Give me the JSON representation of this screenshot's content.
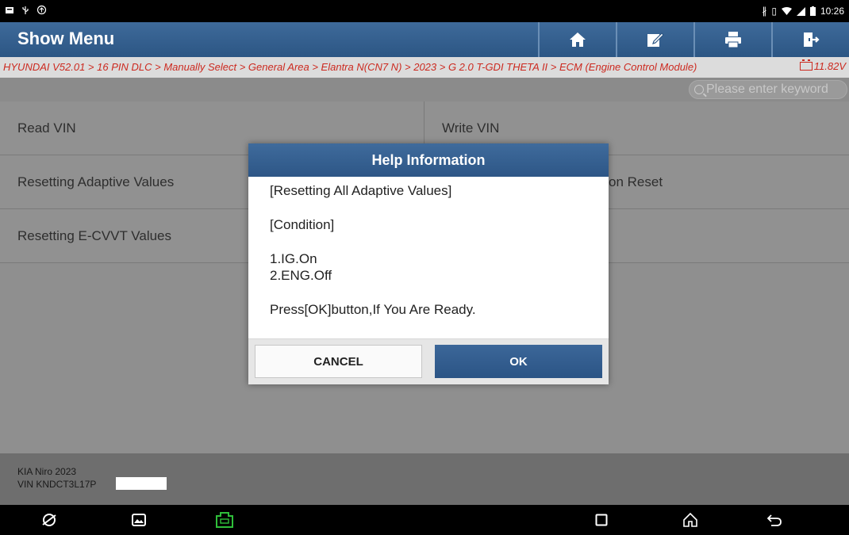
{
  "status_bar": {
    "time": "10:26",
    "left_icons": [
      "notification-icon",
      "usb-icon",
      "sync-icon"
    ],
    "right_icons": [
      "bluetooth-icon",
      "vibrate-icon",
      "wifi-icon",
      "signal-icon",
      "battery-icon"
    ]
  },
  "header": {
    "title": "Show Menu",
    "tools": [
      "home-icon",
      "edit-icon",
      "print-icon",
      "exit-icon"
    ]
  },
  "breadcrumb": {
    "path": "HYUNDAI V52.01 > 16 PIN DLC > Manually Select > General Area > Elantra N(CN7 N) > 2023 > G 2.0 T-GDI THETA II > ECM (Engine Control Module)",
    "voltage": "11.82V"
  },
  "search": {
    "placeholder": "Please enter keyword"
  },
  "menu": {
    "rows": [
      {
        "left": "Read VIN",
        "right": "Write VIN"
      },
      {
        "left": "Resetting Adaptive Values",
        "right": "on Reset"
      },
      {
        "left": "Resetting E-CVVT Values",
        "right": ""
      }
    ]
  },
  "vehicle": {
    "line1": "KIA Niro  2023",
    "line2": "VIN KNDCT3L17P"
  },
  "dialog": {
    "title": "Help Information",
    "line1": "[Resetting All Adaptive Values]",
    "line2": "[Condition]",
    "line3": "1.IG.On",
    "line4": "2.ENG.Off",
    "line5": "Press[OK]button,If You Are Ready.",
    "cancel_label": "CANCEL",
    "ok_label": "OK"
  },
  "colors": {
    "header_blue": "#2c5684",
    "breadcrumb_red": "#cc2a20",
    "vci_green": "#2fbf3a"
  }
}
